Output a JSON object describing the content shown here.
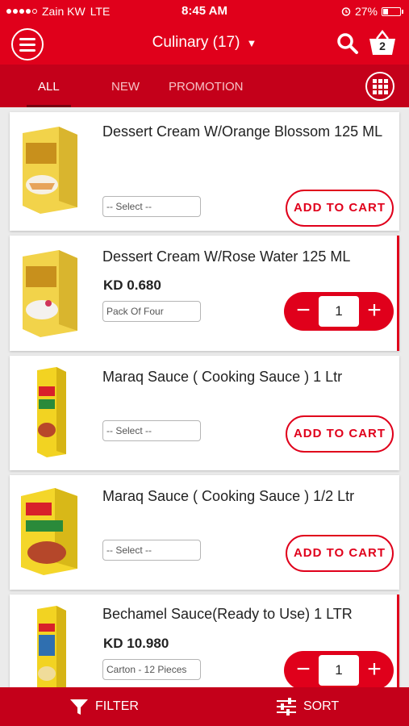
{
  "status_bar": {
    "carrier": "Zain KW",
    "network": "LTE",
    "time": "8:45 AM",
    "battery": "27%",
    "battery_level": 0.27
  },
  "header": {
    "title": "Culinary (17)",
    "caret": "▼",
    "cart_count": "2"
  },
  "tabs": [
    {
      "label": "ALL",
      "active": true
    },
    {
      "label": "NEW",
      "active": false
    },
    {
      "label": "PROMOTION",
      "active": false
    }
  ],
  "products": [
    {
      "name": "Dessert Cream W/Orange Blossom 125 ML",
      "select_value": "-- Select --",
      "action_label": "ADD TO CART"
    },
    {
      "name": "Dessert Cream W/Rose Water 125 ML",
      "price": "KD 0.680",
      "select_value": "Pack Of Four",
      "quantity": "1"
    },
    {
      "name": "Maraq Sauce ( Cooking Sauce ) 1 Ltr",
      "select_value": "-- Select --",
      "action_label": "ADD TO CART"
    },
    {
      "name": "Maraq Sauce ( Cooking Sauce ) 1/2 Ltr",
      "select_value": "-- Select --",
      "action_label": "ADD TO CART"
    },
    {
      "name": "Bechamel Sauce(Ready to Use) 1 LTR",
      "price": "KD 10.980",
      "select_value": "Carton - 12 Pieces",
      "quantity": "1"
    }
  ],
  "stepper": {
    "minus": "−",
    "plus": "+"
  },
  "bottom_bar": {
    "filter_label": "FILTER",
    "sort_label": "SORT"
  },
  "colors": {
    "brand_red": "#e0001b",
    "tab_red": "#c4001a"
  }
}
